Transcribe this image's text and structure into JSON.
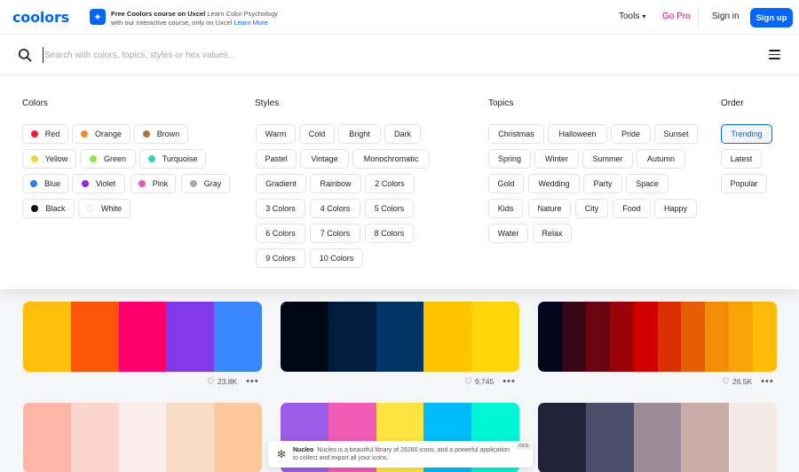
{
  "header": {
    "logo": "coolors",
    "promo_title": "Free Coolors course on Uxcel",
    "promo_body_1": "Learn Color Psychology",
    "promo_body_2": "with our interactive course, only on Uxcel",
    "promo_link": "Learn More",
    "tools_label": "Tools",
    "gopro_label": "Go Pro",
    "signin_label": "Sign in",
    "signup_label": "Sign up"
  },
  "search": {
    "placeholder": "Search with colors, topics, styles or hex values...",
    "value": ""
  },
  "filters": {
    "colors": {
      "title": "Colors",
      "items": [
        {
          "label": "Red",
          "color": "#e8202c"
        },
        {
          "label": "Orange",
          "color": "#f08a2b"
        },
        {
          "label": "Brown",
          "color": "#a97a3c"
        },
        {
          "label": "Yellow",
          "color": "#f5d33a"
        },
        {
          "label": "Green",
          "color": "#8fe84a"
        },
        {
          "label": "Turquoise",
          "color": "#2fd3b5"
        },
        {
          "label": "Blue",
          "color": "#2f7cf0"
        },
        {
          "label": "Violet",
          "color": "#8a2be2"
        },
        {
          "label": "Pink",
          "color": "#e65ab0"
        },
        {
          "label": "Gray",
          "color": "#a9a9a9"
        },
        {
          "label": "Black",
          "color": "#111111"
        },
        {
          "label": "White",
          "color": "#ffffff"
        }
      ]
    },
    "styles": {
      "title": "Styles",
      "items": [
        "Warm",
        "Cold",
        "Bright",
        "Dark",
        "Pastel",
        "Vintage",
        "Monochromatic",
        "Gradient",
        "Rainbow",
        "2 Colors",
        "3 Colors",
        "4 Colors",
        "5 Colors",
        "6 Colors",
        "7 Colors",
        "8 Colors",
        "9 Colors",
        "10 Colors"
      ]
    },
    "topics": {
      "title": "Topics",
      "items": [
        "Christmas",
        "Halloween",
        "Pride",
        "Sunset",
        "Spring",
        "Winter",
        "Summer",
        "Autumn",
        "Gold",
        "Wedding",
        "Party",
        "Space",
        "Kids",
        "Nature",
        "City",
        "Food",
        "Happy",
        "Water",
        "Relax"
      ]
    },
    "order": {
      "title": "Order",
      "items": [
        "Trending",
        "Latest",
        "Popular"
      ],
      "selected": "Trending"
    }
  },
  "palettes": [
    {
      "colors": [
        "#ffbe0b",
        "#fb5607",
        "#ff006e",
        "#8338ec",
        "#3a86ff"
      ],
      "likes": "23.8K"
    },
    {
      "colors": [
        "#000814",
        "#001d3d",
        "#003566",
        "#ffc300",
        "#ffd60a"
      ],
      "likes": "9,745"
    },
    {
      "colors": [
        "#03071e",
        "#370617",
        "#6a040f",
        "#9d0208",
        "#d00000",
        "#dc2f02",
        "#e85d04",
        "#f48c06",
        "#faa307",
        "#ffba08"
      ],
      "likes": "26.5K"
    },
    {
      "colors": [
        "#ffb5a7",
        "#fcd5ce",
        "#f8edeb",
        "#f9dcc4",
        "#fec89a"
      ],
      "likes": ""
    },
    {
      "colors": [
        "#9b5de5",
        "#f15bb5",
        "#fee440",
        "#00bbf9",
        "#00f5d4"
      ],
      "likes": ""
    },
    {
      "colors": [
        "#22223b",
        "#4a4e69",
        "#9a8c98",
        "#c9ada7",
        "#f2e9e4"
      ],
      "likes": ""
    }
  ],
  "ad": {
    "brand": "Nucleo",
    "text": "Nucleo is a beautiful library of 29280 icons, and a powerful application to collect and export all your icons.",
    "hide_label": "HIDE"
  }
}
